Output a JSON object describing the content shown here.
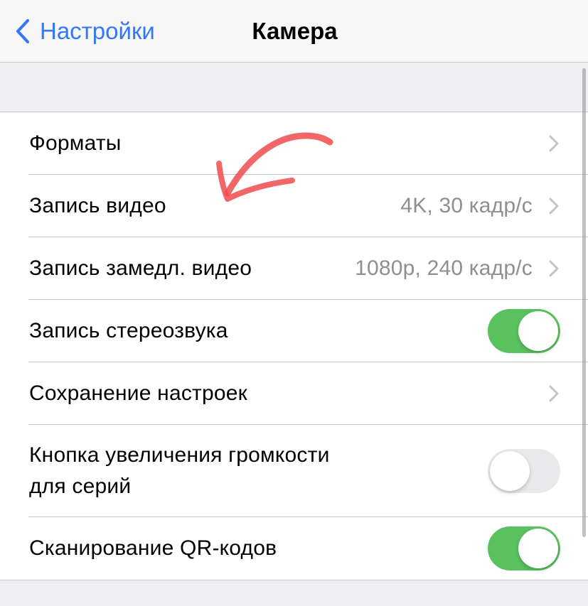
{
  "nav": {
    "back_label": "Настройки",
    "title": "Камера"
  },
  "rows": [
    {
      "label": "Форматы",
      "value": "",
      "type": "chevron"
    },
    {
      "label": "Запись видео",
      "value": "4K, 30 кадр/с",
      "type": "chevron"
    },
    {
      "label": "Запись замедл. видео",
      "value": "1080p, 240 кадр/с",
      "type": "chevron"
    },
    {
      "label": "Запись стереозвука",
      "type": "toggle",
      "on": true
    },
    {
      "label": "Сохранение настроек",
      "type": "chevron"
    },
    {
      "label_line1": "Кнопка увеличения громкости",
      "label_line2": "для серий",
      "type": "toggle",
      "on": false
    },
    {
      "label": "Сканирование QR-кодов",
      "type": "toggle",
      "on": true
    }
  ],
  "colors": {
    "accent": "#3478f6",
    "toggle_on": "#5ac15f",
    "toggle_off": "#e9e9eb",
    "annotation_arrow": "#ef4b4b"
  },
  "icons": {
    "back": "chevron-left-icon",
    "disclosure": "chevron-right-icon",
    "annotation": "hand-drawn-arrow-icon"
  }
}
